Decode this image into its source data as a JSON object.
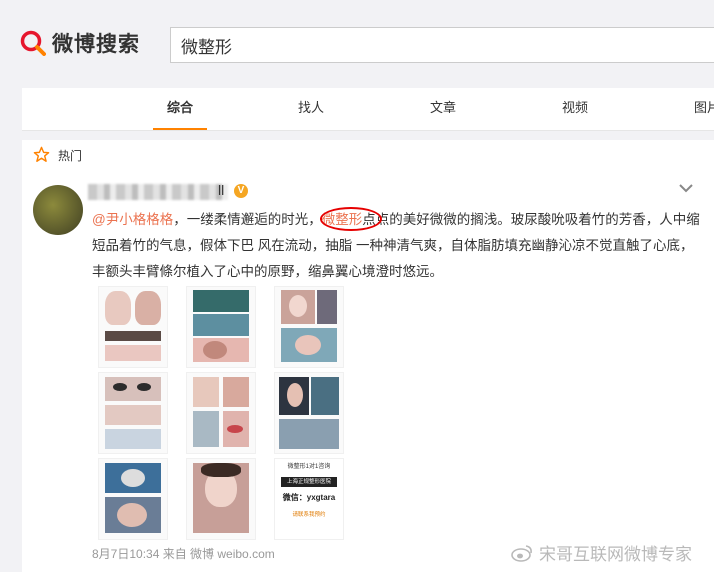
{
  "header": {
    "logo_text": "微博搜索",
    "search_value": "微整形",
    "accent": "#ff8200"
  },
  "tabs": [
    {
      "label": "综合"
    },
    {
      "label": "找人"
    },
    {
      "label": "文章"
    },
    {
      "label": "视频"
    },
    {
      "label": "图片"
    }
  ],
  "hot": {
    "label": "热门"
  },
  "post": {
    "username_suffix": "ll",
    "verified_icon": "V",
    "mention": "@尹小格格格",
    "text_before_kw": "，一缕柔情邂逅的时光，",
    "keyword": "微整形",
    "text_after_kw": "点点的美好微微的搁浅。玻尿酸吮吸着竹的芳香，人中缩短品着竹的气息，假体下巴 风在流动，抽脂 一种神清气爽，自体脂肪填充幽静沁凉不觉直触了心底，丰额头丰臂條尔植入了心中的原野，缩鼻翼心境澄时悠远。",
    "meta": "8月7日10:34 来自 微博 weibo.com",
    "images": [
      {
        "name": "collage-1"
      },
      {
        "name": "surgery-photo"
      },
      {
        "name": "portrait-collage"
      },
      {
        "name": "eyes-collage"
      },
      {
        "name": "face-collage"
      },
      {
        "name": "profile-collage"
      },
      {
        "name": "mask-collage"
      },
      {
        "name": "beauty-portrait"
      },
      {
        "name": "wechat-card"
      }
    ],
    "card_text": {
      "line1": "微整形1对1咨询",
      "line2": "上海正规整形医院",
      "wechat_label": "微信：",
      "wechat_id": "yxgtara",
      "footer": "请联系我预约"
    }
  },
  "watermark": "宋哥互联网微博专家"
}
